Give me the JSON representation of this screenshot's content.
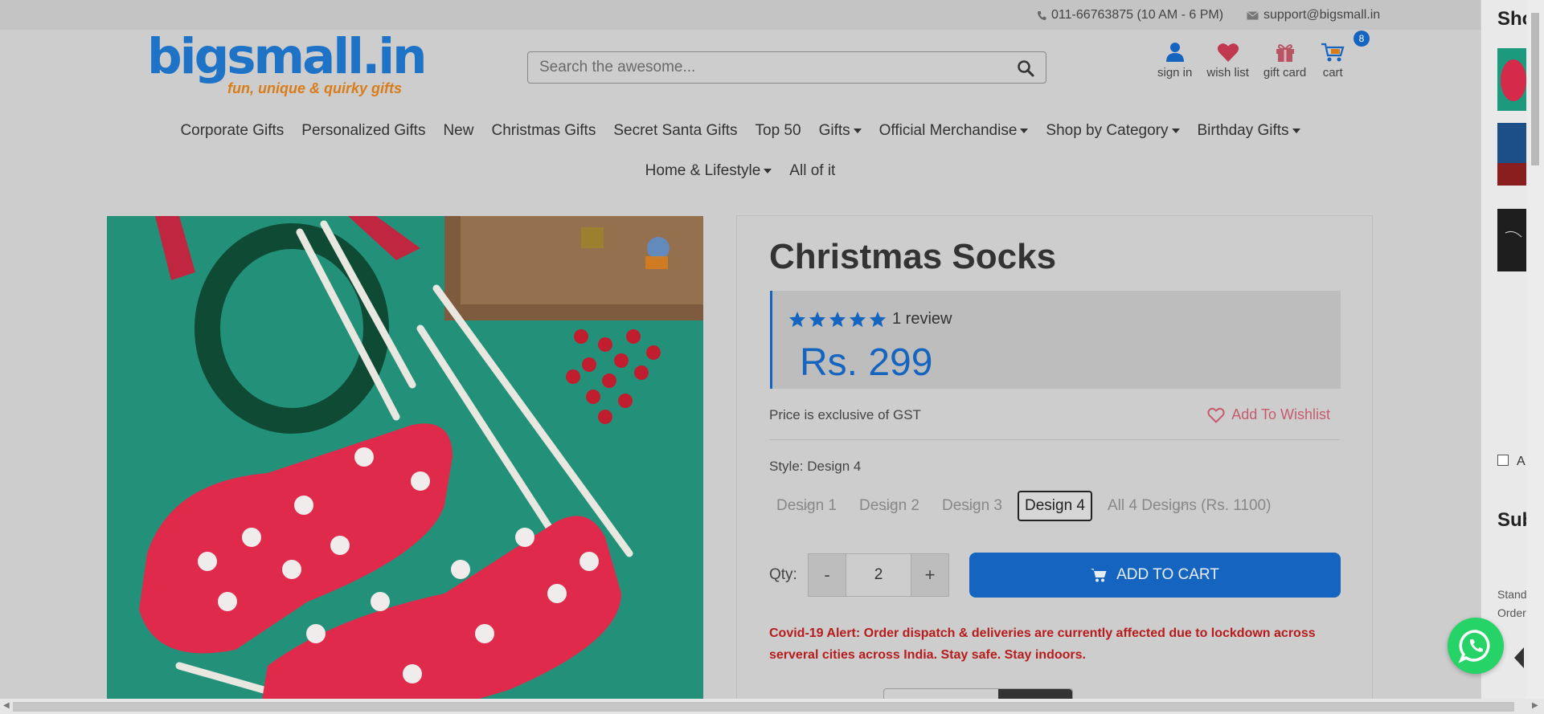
{
  "topbar": {
    "phone": "011-66763875 (10 AM - 6 PM)",
    "email": "support@bigsmall.in"
  },
  "logo": {
    "brand": "bigsmall.in",
    "tagline": "fun, unique & quirky gifts"
  },
  "search": {
    "placeholder": "Search the awesome..."
  },
  "user_icons": {
    "signin": "sign in",
    "wishlist": "wish list",
    "giftcard": "gift card",
    "cart": "cart",
    "cart_count": "8"
  },
  "nav": {
    "row1": [
      {
        "label": "Corporate Gifts",
        "dropdown": false
      },
      {
        "label": "Personalized Gifts",
        "dropdown": false
      },
      {
        "label": "New",
        "dropdown": false
      },
      {
        "label": "Christmas Gifts",
        "dropdown": false
      },
      {
        "label": "Secret Santa Gifts",
        "dropdown": false
      },
      {
        "label": "Top 50",
        "dropdown": false
      },
      {
        "label": "Gifts",
        "dropdown": true
      },
      {
        "label": "Official Merchandise",
        "dropdown": true
      },
      {
        "label": "Shop by Category",
        "dropdown": true
      },
      {
        "label": "Birthday Gifts",
        "dropdown": true
      }
    ],
    "row2": [
      {
        "label": "Home & Lifestyle",
        "dropdown": true
      },
      {
        "label": "All of it",
        "dropdown": false
      }
    ]
  },
  "product": {
    "title": "Christmas Socks",
    "rating_stars": 5,
    "review_text": "1 review",
    "price": "Rs. 299",
    "gst_note": "Price is exclusive of GST",
    "wishlist_label": "Add To Wishlist",
    "style_label": "Style: Design 4",
    "designs": [
      {
        "label": "Design 1",
        "state": "unavailable"
      },
      {
        "label": "Design 2",
        "state": "unavailable"
      },
      {
        "label": "Design 3",
        "state": "unavailable"
      },
      {
        "label": "Design 4",
        "state": "selected"
      },
      {
        "label": "All 4 Designs (Rs. 1100)",
        "state": "unavailable"
      }
    ],
    "qty_label": "Qty:",
    "qty_minus": "-",
    "qty_value": "2",
    "qty_plus": "+",
    "add_to_cart": "ADD TO CART",
    "covid_alert": "Covid-19 Alert: Order dispatch & deliveries are currently affected due to lockdown across serveral cities across India. Stay safe. Stay indoors."
  },
  "side_panel": {
    "heading": "Sho",
    "checkbox_label": "A",
    "subheading": "Sub",
    "line1": "Stand",
    "line2": "Order"
  },
  "colors": {
    "brand_blue": "#1565c0",
    "alert_red": "#b71c1c",
    "whatsapp_green": "#25d366"
  }
}
